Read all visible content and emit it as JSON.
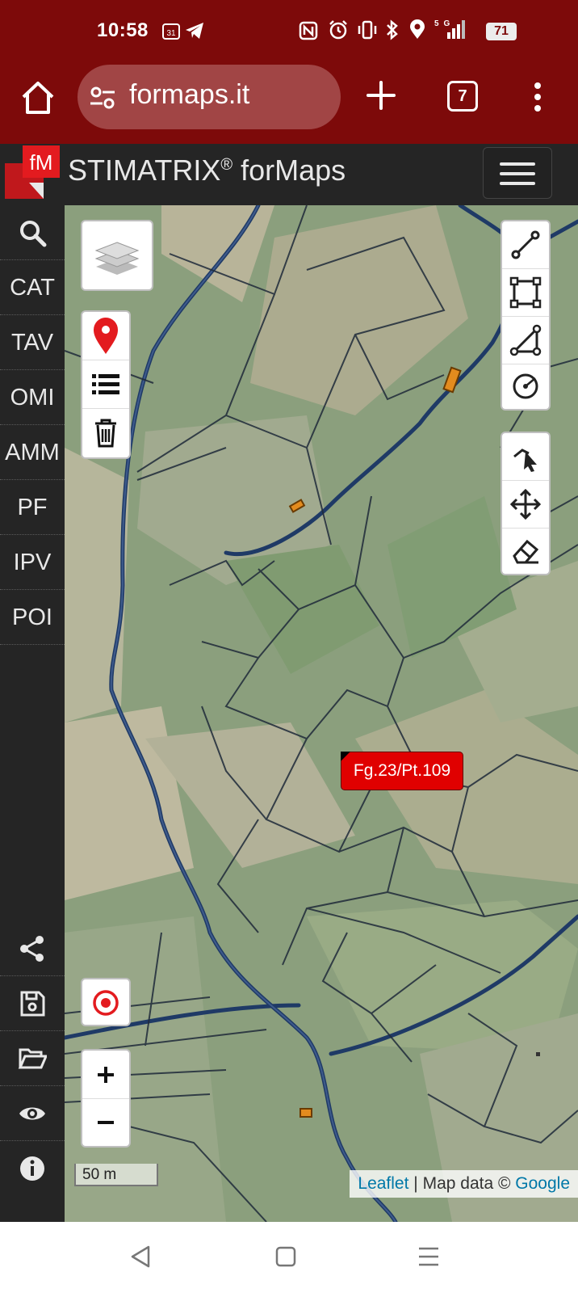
{
  "status_bar": {
    "time": "10:58",
    "left_icons": [
      "calendar-icon",
      "telegram-icon"
    ],
    "calendar_text": "31",
    "right_icons": [
      "nfc-icon",
      "alarm-icon",
      "vibrate-icon",
      "bluetooth-icon",
      "location-icon",
      "signal-5g-icon"
    ],
    "network": "5G",
    "battery": "71"
  },
  "browser": {
    "url": "formaps.it",
    "tab_count": "7"
  },
  "app": {
    "logo_text": "fM",
    "title": "STIMATRIX",
    "title_mark": "®",
    "title_suffix": " forMaps"
  },
  "sidebar": {
    "items": [
      {
        "label": "CAT"
      },
      {
        "label": "TAV"
      },
      {
        "label": "OMI"
      },
      {
        "label": "AMM"
      },
      {
        "label": "PF"
      },
      {
        "label": "IPV"
      },
      {
        "label": "POI"
      }
    ],
    "bottom_icons": [
      "share-icon",
      "save-icon",
      "folder-open-icon",
      "eye-icon",
      "info-icon"
    ]
  },
  "map": {
    "parcel_label": "Fg.23/Pt.109",
    "scale": "50 m",
    "attribution_link1": "Leaflet",
    "attribution_sep": " | Map data © ",
    "attribution_link2": "Google"
  },
  "colors": {
    "browser_bar": "#7d0a0a",
    "app_dark": "#252525",
    "marker_red": "#e00000",
    "parcel_line": "#1f2a44"
  }
}
